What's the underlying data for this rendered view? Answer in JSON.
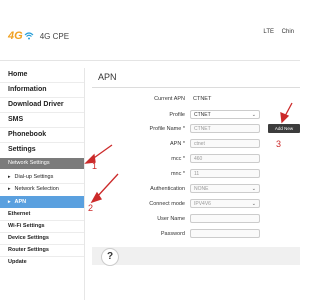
{
  "header": {
    "logo_4g": "4G",
    "app_title": "4G CPE",
    "right_items": [
      "LTE",
      "Chin"
    ]
  },
  "sidebar": {
    "items": {
      "home": "Home",
      "information": "Information",
      "download_driver": "Download Driver",
      "sms": "SMS",
      "phonebook": "Phonebook",
      "settings": "Settings",
      "network_settings": "Network Settings",
      "dialup": "Dial-up Settings",
      "network_selection": "Network Selection",
      "apn": "APN",
      "ethernet": "Ethernet",
      "wifi": "Wi-Fi Settings",
      "device": "Device Settings",
      "router": "Router Settings",
      "update": "Update"
    }
  },
  "main": {
    "title": "APN",
    "current_apn_label": "Current APN",
    "current_apn_value": "CTNET",
    "profile_label": "Profile",
    "profile_value": "CTNET",
    "profile_name_label": "Profile Name *",
    "profile_name_value": "CTNET",
    "apn_label": "APN *",
    "apn_value": "ctnet",
    "mcc_label": "mcc *",
    "mcc_value": "460",
    "mnc_label": "mnc *",
    "mnc_value": "11",
    "auth_label": "Authentication",
    "auth_value": "NONE",
    "connect_mode_label": "Connect mode",
    "connect_mode_value": "IPV4V6",
    "username_label": "User Name",
    "password_label": "Password",
    "add_new_label": "Add New",
    "help_label": "?"
  },
  "annotations": {
    "a1": "1",
    "a2": "2",
    "a3": "3"
  },
  "colors": {
    "accent_blue": "#5aa0df",
    "annotation_red": "#cc2a2a",
    "group_gray": "#7b7b7b"
  }
}
